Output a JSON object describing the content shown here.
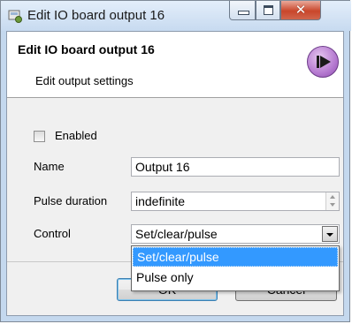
{
  "window": {
    "title": "Edit IO board output 16",
    "icon": "app-icon"
  },
  "header": {
    "title": "Edit IO board output 16",
    "subtitle": "Edit output settings",
    "action_icon": "play-next-icon"
  },
  "form": {
    "enabled": {
      "label": "Enabled",
      "checked": false
    },
    "name": {
      "label": "Name",
      "value": "Output 16"
    },
    "pulse_duration": {
      "label": "Pulse duration",
      "value": "indefinite"
    },
    "control": {
      "label": "Control",
      "value": "Set/clear/pulse",
      "options": [
        "Set/clear/pulse",
        "Pulse only"
      ],
      "expanded": true
    }
  },
  "buttons": {
    "ok": "OK",
    "cancel": "Cancel"
  },
  "colors": {
    "selection": "#3399ff",
    "accent_play": "#b57ad0"
  }
}
